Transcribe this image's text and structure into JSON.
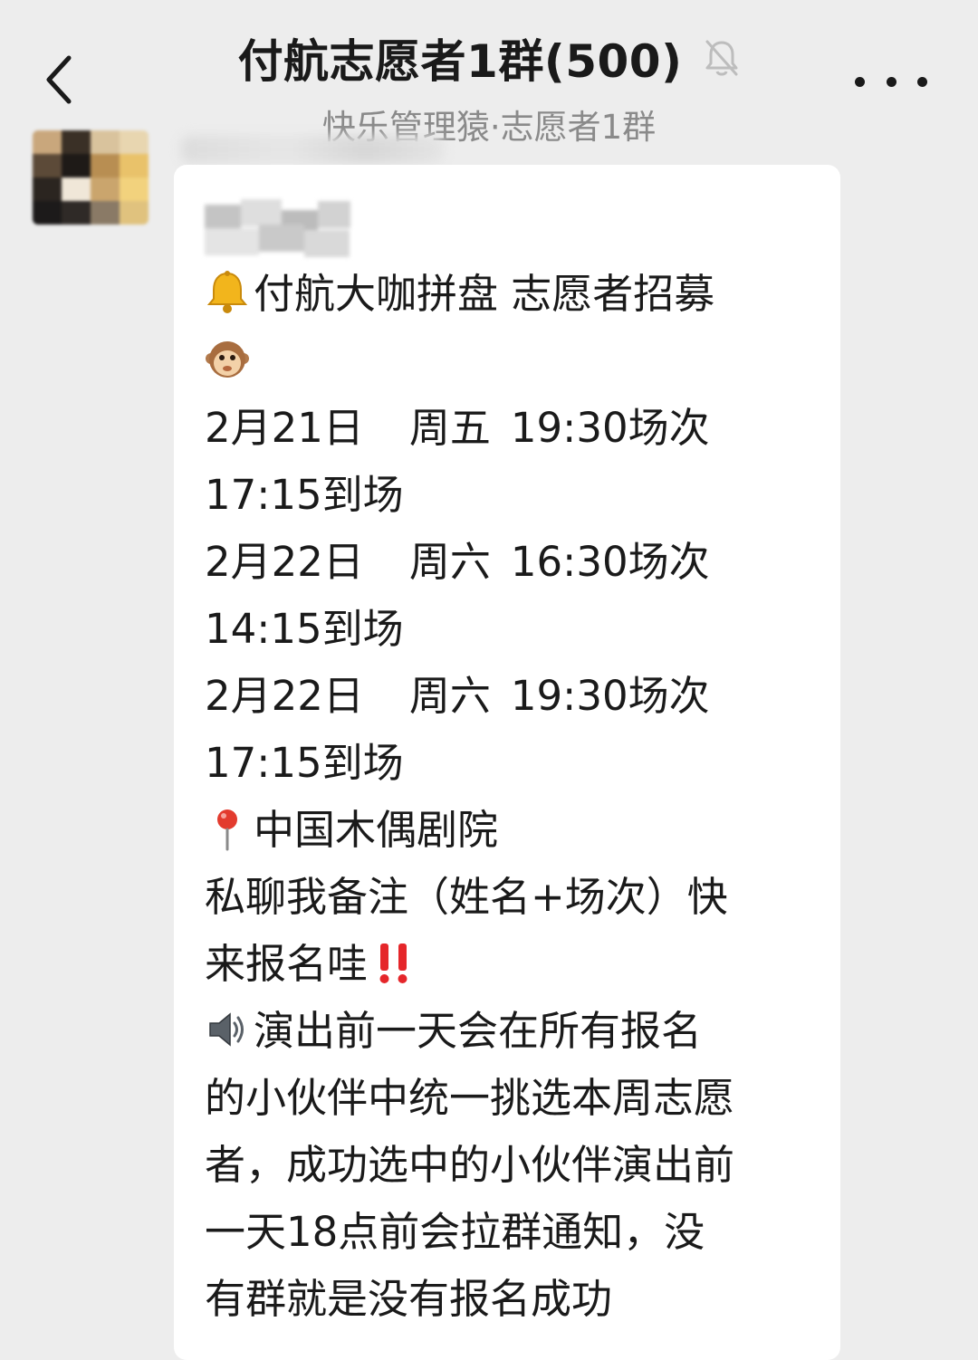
{
  "header": {
    "title": "付航志愿者1群(500)",
    "subtitle": "快乐管理猿·志愿者1群",
    "back_icon": "chevron-left-icon",
    "mute_icon": "bell-off-icon",
    "more_icon": "more-horizontal-icon"
  },
  "message": {
    "headline": "付航大咖拼盘 志愿者招募",
    "sessions": [
      {
        "date": "2月21日",
        "weekday": "周五",
        "show": "19:30场次",
        "arrive": "17:15到场"
      },
      {
        "date": "2月22日",
        "weekday": "周六",
        "show": "16:30场次",
        "arrive": "14:15到场"
      },
      {
        "date": "2月22日",
        "weekday": "周六",
        "show": "19:30场次",
        "arrive": "17:15到场"
      }
    ],
    "venue": "中国木偶剧院",
    "signup_line1": "私聊我备注（姓名+场次）快",
    "signup_line2": "来报名哇",
    "notice_lines": [
      "演出前一天会在所有报名",
      "的小伙伴中统一挑选本周志愿",
      "者，成功选中的小伙伴演出前",
      "一天18点前会拉群通知，没",
      "有群就是没有报名成功"
    ]
  },
  "colors": {
    "background": "#ededed",
    "bubble": "#ffffff",
    "text": "#1a1a1a",
    "subtitle": "#8a8a8a",
    "exclaim": "#e5262a"
  }
}
